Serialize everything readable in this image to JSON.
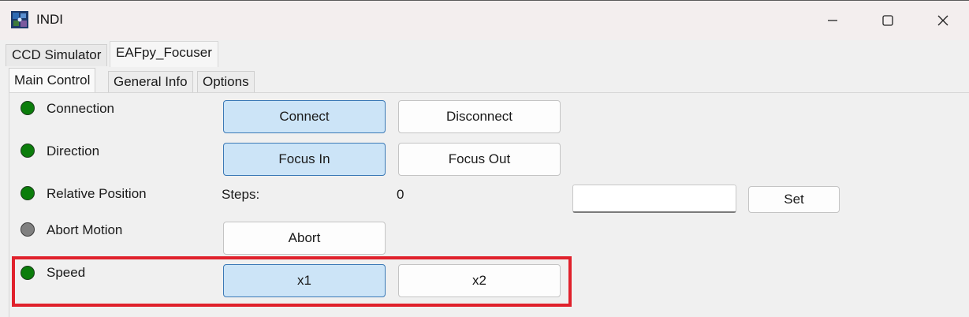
{
  "window": {
    "title": "INDI",
    "icon": "indi-app-icon",
    "controls": [
      "minimize-icon",
      "maximize-icon",
      "close-icon"
    ]
  },
  "device_tabs": [
    {
      "label": "CCD Simulator",
      "active": false
    },
    {
      "label": "EAFpy_Focuser",
      "active": true
    }
  ],
  "group_tabs": [
    {
      "label": "Main Control",
      "active": true
    },
    {
      "label": "General Info",
      "active": false
    },
    {
      "label": "Options",
      "active": false
    }
  ],
  "properties": {
    "connection": {
      "label": "Connection",
      "state": "ok",
      "buttons": [
        {
          "label": "Connect",
          "on": true
        },
        {
          "label": "Disconnect",
          "on": false
        }
      ]
    },
    "direction": {
      "label": "Direction",
      "state": "ok",
      "buttons": [
        {
          "label": "Focus In",
          "on": true
        },
        {
          "label": "Focus Out",
          "on": false
        }
      ]
    },
    "relative_position": {
      "label": "Relative Position",
      "state": "ok",
      "field_label": "Steps:",
      "value": "0",
      "input_value": "",
      "set_label": "Set"
    },
    "abort_motion": {
      "label": "Abort Motion",
      "state": "idle",
      "buttons": [
        {
          "label": "Abort",
          "on": false
        }
      ]
    },
    "speed": {
      "label": "Speed",
      "state": "ok",
      "buttons": [
        {
          "label": "x1",
          "on": true
        },
        {
          "label": "x2",
          "on": false
        }
      ]
    }
  },
  "colors": {
    "led_ok": "#0b7d0b",
    "led_idle": "#808080",
    "button_on": "#cce4f7",
    "highlight": "#e0212c"
  }
}
